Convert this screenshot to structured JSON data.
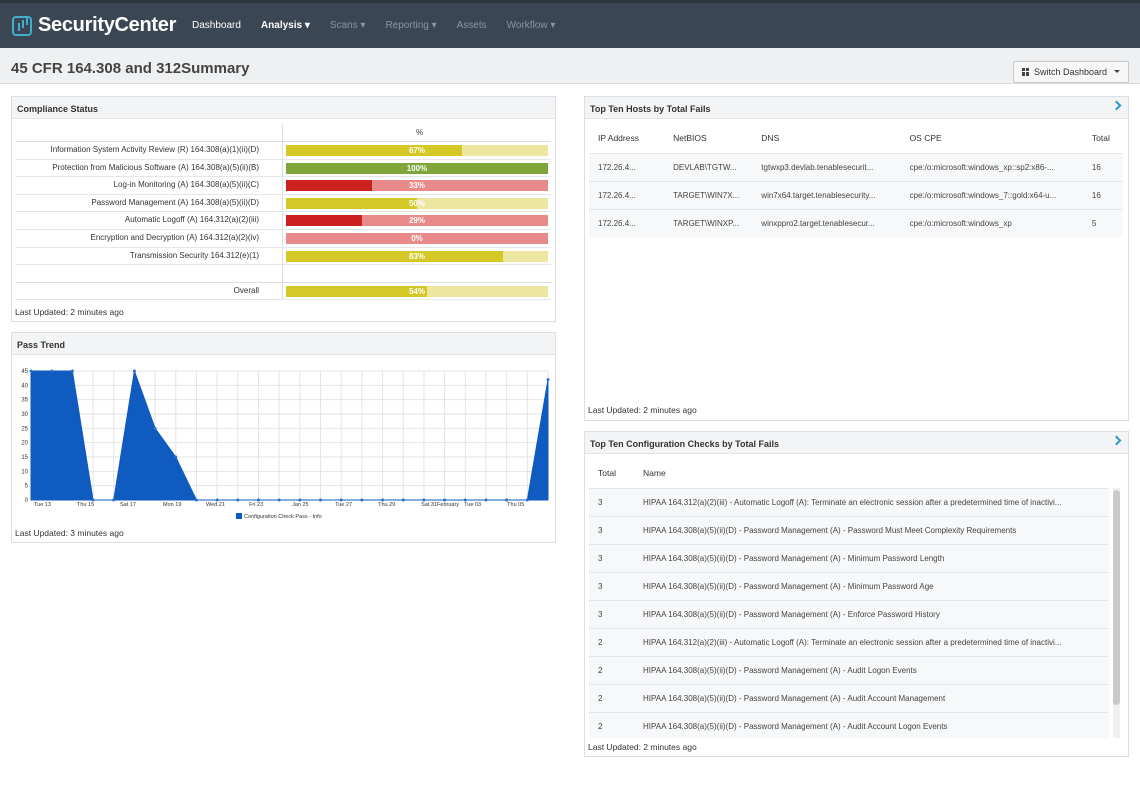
{
  "app": {
    "name": "SecurityCenter"
  },
  "nav": [
    {
      "label": "Dashboard",
      "state": "active"
    },
    {
      "label": "Analysis ▾",
      "state": "bold"
    },
    {
      "label": "Scans ▾",
      "state": "dim"
    },
    {
      "label": "Reporting ▾",
      "state": "dim"
    },
    {
      "label": "Assets",
      "state": "dim"
    },
    {
      "label": "Workflow ▾",
      "state": "dim"
    }
  ],
  "page": {
    "title": "45 CFR 164.308 and 312Summary",
    "switch_label": "Switch Dashboard"
  },
  "compliance": {
    "title": "Compliance Status",
    "col_header": "%",
    "rows": [
      {
        "label": "Information System Activity Review (R) 164.308(a)(1)(ii)(D)",
        "pct": 67,
        "pct_label": "67%",
        "fill": "#d4c826",
        "bg": "#ece6a0"
      },
      {
        "label": "Protection from Malicious Software (A) 164.308(a)(5)(ii)(B)",
        "pct": 100,
        "pct_label": "100%",
        "fill": "#7fa63a",
        "bg": "#bcd48e"
      },
      {
        "label": "Log-in Monitoring (A) 164.308(a)(5)(ii)(C)",
        "pct": 33,
        "pct_label": "33%",
        "fill": "#cc1f1f",
        "bg": "#e88a8a"
      },
      {
        "label": "Password Management (A) 164.308(a)(5)(ii)(D)",
        "pct": 50,
        "pct_label": "50%",
        "fill": "#d4c826",
        "bg": "#ece6a0"
      },
      {
        "label": "Automatic Logoff (A) 164.312(a)(2)(iii)",
        "pct": 29,
        "pct_label": "29%",
        "fill": "#cc1f1f",
        "bg": "#e88a8a"
      },
      {
        "label": "Encryption and Decryption (A) 164.312(a)(2)(iv)",
        "pct": 0,
        "pct_label": "0%",
        "fill": "#cc1f1f",
        "bg": "#e88a8a"
      },
      {
        "label": "Transmission Security 164.312(e)(1)",
        "pct": 83,
        "pct_label": "83%",
        "fill": "#d4c826",
        "bg": "#ece6a0"
      }
    ],
    "overall": {
      "label": "Overall",
      "pct": 54,
      "pct_label": "54%",
      "fill": "#d4c826",
      "bg": "#ece6a0"
    },
    "updated": "Last Updated: 2 minutes ago"
  },
  "trend": {
    "title": "Pass Trend",
    "updated": "Last Updated: 3 minutes ago",
    "legend": "Configuration Check Pass - Info",
    "color": "#0f5bbf"
  },
  "chart_data": {
    "type": "area",
    "title": "Pass Trend",
    "ylim": [
      0,
      45
    ],
    "yticks": [
      0,
      5,
      10,
      15,
      20,
      25,
      30,
      35,
      40,
      45
    ],
    "xticks": [
      "Tue 13",
      "Thu 15",
      "Sat 17",
      "Mon 19",
      "Wed 21",
      "Fri 23",
      "Jan 25",
      "Tue 27",
      "Thu 29",
      "Sat 31February",
      "Tue 03",
      "Thu 05"
    ],
    "x_min": 0,
    "x_max": 25,
    "series": [
      {
        "name": "Configuration Check Pass - Info",
        "points": [
          [
            0,
            45
          ],
          [
            1,
            45
          ],
          [
            2,
            45
          ],
          [
            3,
            0
          ],
          [
            4,
            0
          ],
          [
            5,
            45
          ],
          [
            6,
            25
          ],
          [
            7,
            15
          ],
          [
            8,
            0
          ],
          [
            9,
            0
          ],
          [
            10,
            0
          ],
          [
            11,
            0
          ],
          [
            12,
            0
          ],
          [
            13,
            0
          ],
          [
            14,
            0
          ],
          [
            15,
            0
          ],
          [
            16,
            0
          ],
          [
            17,
            0
          ],
          [
            18,
            0
          ],
          [
            19,
            0
          ],
          [
            20,
            0
          ],
          [
            21,
            0
          ],
          [
            22,
            0
          ],
          [
            23,
            0
          ],
          [
            24,
            0
          ],
          [
            25,
            42
          ]
        ]
      }
    ],
    "grid": true,
    "legend_position": "bottom"
  },
  "hosts": {
    "title": "Top Ten Hosts by Total Fails",
    "columns": [
      "IP Address",
      "NetBIOS",
      "DNS",
      "OS CPE",
      "Total"
    ],
    "rows": [
      [
        "172.26.4...",
        "DEVLAB\\TGTW...",
        "tgtwxp3.devlab.tenablesecurit...",
        "cpe:/o:microsoft:windows_xp::sp2:x86-...",
        "16"
      ],
      [
        "172.26.4...",
        "TARGET\\WIN7X...",
        "win7x64.target.tenablesecurity...",
        "cpe:/o:microsoft:windows_7::gold:x64-u...",
        "16"
      ],
      [
        "172.26.4...",
        "TARGET\\WINXP...",
        "winxppro2.target.tenablesecur...",
        "cpe:/o:microsoft:windows_xp",
        "5"
      ]
    ],
    "updated": "Last Updated: 2 minutes ago"
  },
  "checks": {
    "title": "Top Ten Configuration Checks by Total Fails",
    "columns": [
      "Total",
      "Name"
    ],
    "rows": [
      [
        "3",
        "HIPAA 164.312(a)(2)(iii) - Automatic Logoff (A): Terminate an electronic session after a predetermined time of inactivi..."
      ],
      [
        "3",
        "HIPAA 164.308(a)(5)(ii)(D) - Password Management (A) - Password Must Meet Complexity Requirements"
      ],
      [
        "3",
        "HIPAA 164.308(a)(5)(ii)(D) - Password Management (A) - Minimum Password Length"
      ],
      [
        "3",
        "HIPAA 164.308(a)(5)(ii)(D) - Password Management (A) - Minimum Password Age"
      ],
      [
        "3",
        "HIPAA 164.308(a)(5)(ii)(D) - Password Management (A) - Enforce Password History"
      ],
      [
        "2",
        "HIPAA 164.312(a)(2)(iii) - Automatic Logoff (A): Terminate an electronic session after a predetermined time of inactivi..."
      ],
      [
        "2",
        "HIPAA 164.308(a)(5)(ii)(D) - Password Management (A) - Audit Logon Events"
      ],
      [
        "2",
        "HIPAA 164.308(a)(5)(ii)(D) - Password Management (A) - Audit Account Management"
      ],
      [
        "2",
        "HIPAA 164.308(a)(5)(ii)(D) - Password Management (A) - Audit Account Logon Events"
      ]
    ],
    "updated": "Last Updated: 2 minutes ago"
  }
}
